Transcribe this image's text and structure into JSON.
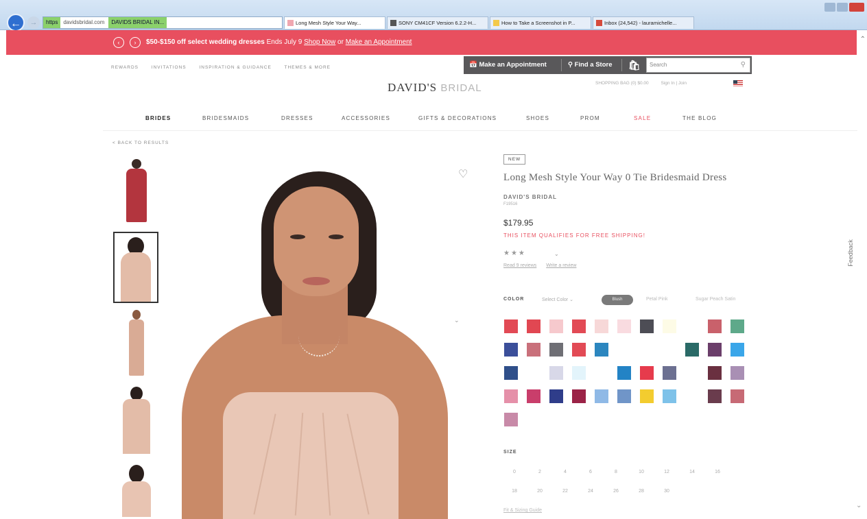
{
  "browser": {
    "back_icon": "back-arrow-icon",
    "address_secure": "https",
    "address_url": "davidsbridal.com",
    "address_site": "DAVIDS BRIDAL IN...",
    "tabs": [
      {
        "label": "Long Mesh Style Your Way...",
        "color": "#f0a7b0"
      },
      {
        "label": "SONY CM41CF Version 6.2.2-H...",
        "color": "#555555"
      },
      {
        "label": "How to Take a Screenshot in P...",
        "color": "#f3c94a"
      },
      {
        "label": "Inbox (24,542) - lauramichelle...",
        "color": "#d64a3b"
      }
    ]
  },
  "promo": {
    "offer": "$50-$150 off select wedding dresses",
    "ends": "Ends July 9",
    "shop_now": "Shop Now",
    "or": "or",
    "appointment": "Make an Appointment",
    "prev_icon": "chevron-left-icon",
    "next_icon": "chevron-right-icon"
  },
  "utility_nav": [
    "REWARDS",
    "INVITATIONS",
    "INSPIRATION & GUIDANCE",
    "THEMES & MORE"
  ],
  "tools": {
    "appointment": "Make an Appointment",
    "store": "Find a Store",
    "search_placeholder": "Search"
  },
  "logo": {
    "bold": "DAVID'S",
    "light": "BRIDAL"
  },
  "account": {
    "links": [
      "SHOPPING BAG (0) $0.00",
      "Sign In | Join"
    ]
  },
  "main_nav": [
    {
      "label": "BRIDES",
      "active": true
    },
    {
      "label": "BRIDESMAIDS",
      "active": false
    },
    {
      "label": "DRESSES",
      "active": false
    },
    {
      "label": "ACCESSORIES",
      "active": false
    },
    {
      "label": "GIFTS & DECORATIONS",
      "active": false
    },
    {
      "label": "SHOES",
      "active": false
    },
    {
      "label": "PROM",
      "active": false
    },
    {
      "label": "SALE",
      "active": false
    },
    {
      "label": "THE BLOG",
      "active": false
    }
  ],
  "back_to_results": "< BACK TO RESULTS",
  "product": {
    "badge": "NEW",
    "title": "Long Mesh Style Your Way 0 Tie Bridesmaid Dress",
    "brand": "DAVID'S BRIDAL",
    "sku": "F19516",
    "price": "$179.95",
    "shipping": "THIS ITEM QUALIFIES FOR FREE SHIPPING!",
    "rating_stars": "★★★",
    "read_reviews": "Read 9 reviews",
    "write_review": "Write a review",
    "color_label": "COLOR",
    "color_select": "Select Color",
    "color_selected": "Blush",
    "color_option_2": "Petal Pink",
    "color_option_3": "Sugar Peach Satin",
    "size_label": "SIZE",
    "sizes": [
      "0",
      "2",
      "4",
      "6",
      "8",
      "10",
      "12",
      "14",
      "16",
      "18",
      "20",
      "22",
      "24",
      "26",
      "28",
      "30"
    ],
    "fit_guide": "Fit & Sizing Guide",
    "swatch_colors": [
      "#e24a55",
      "#e14752",
      "#f6c9cd",
      "#e24a55",
      "#f7d8d8",
      "#f9dbe0",
      "#4d4d55",
      "#fdfbe6",
      "#ffffff",
      "#c9616b",
      "#5ea98a",
      "#3b4f9a",
      "#c9707b",
      "#6f6f75",
      "#e24a55",
      "#2c86bf",
      "#ffffff",
      "#ffffff",
      "#ffffff",
      "#2a6a67",
      "#6b3e6a",
      "#3aa6e9",
      "#2f4f8a",
      "#ffffff",
      "#d8d8e8",
      "#e3f4fb",
      "#ffffff",
      "#2383c5",
      "#e63b4c",
      "#6c7091",
      "#ffffff",
      "#6a3040",
      "#a98fb4",
      "#e590a9",
      "#c93e6b",
      "#2f3d8a",
      "#9b2347",
      "#8fb9e6",
      "#7095c8",
      "#f3cc2f",
      "#7ec2e9",
      "#ffffff",
      "#6a3c4d",
      "#c76a75",
      "#c88aa8"
    ]
  },
  "feedback": "Feedback",
  "heart_icon": "heart-icon",
  "search_icon": "search-icon"
}
